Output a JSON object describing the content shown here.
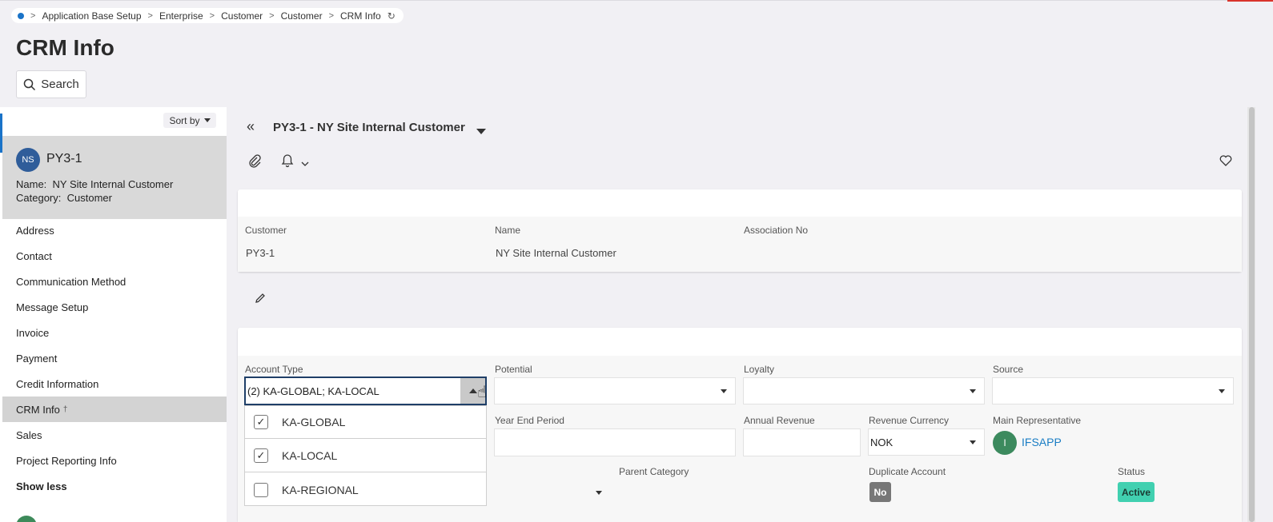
{
  "breadcrumb": {
    "items": [
      "Application Base Setup",
      "Enterprise",
      "Customer",
      "Customer",
      "CRM Info"
    ],
    "separator": ">"
  },
  "page": {
    "title": "CRM Info",
    "search_label": "Search"
  },
  "left_panel": {
    "sort_label": "Sort by",
    "record": {
      "initials": "NS",
      "id": "PY3-1",
      "name_label": "Name:",
      "name_value": "NY Site Internal Customer",
      "category_label": "Category:",
      "category_value": "Customer"
    },
    "nav_items": [
      "Address",
      "Contact",
      "Communication Method",
      "Message Setup",
      "Invoice",
      "Payment",
      "Credit Information",
      "CRM Info",
      "Sales",
      "Project Reporting Info"
    ],
    "active_item": "CRM Info",
    "show_less": "Show less"
  },
  "main": {
    "header_title": "PY3-1 - NY Site Internal Customer",
    "card1": {
      "fields": [
        {
          "label": "Customer",
          "value": "PY3-1"
        },
        {
          "label": "Name",
          "value": "NY Site Internal Customer"
        },
        {
          "label": "Association No",
          "value": ""
        }
      ]
    },
    "card2": {
      "account_type": {
        "label": "Account Type",
        "value": "(2) KA-GLOBAL; KA-LOCAL"
      },
      "potential": {
        "label": "Potential",
        "value": ""
      },
      "loyalty": {
        "label": "Loyalty",
        "value": ""
      },
      "source": {
        "label": "Source",
        "value": ""
      },
      "year_end_period": {
        "label": "Year End Period",
        "value": ""
      },
      "annual_revenue": {
        "label": "Annual Revenue",
        "value": ""
      },
      "revenue_currency": {
        "label": "Revenue Currency",
        "value": "NOK"
      },
      "main_representative": {
        "label": "Main Representative",
        "initial": "I",
        "value": "IFSAPP"
      },
      "parent_category": {
        "label": "Parent Category"
      },
      "duplicate_account": {
        "label": "Duplicate Account",
        "value": "No"
      },
      "status": {
        "label": "Status",
        "value": "Active"
      }
    },
    "account_type_options": [
      {
        "label": "KA-GLOBAL",
        "checked": true
      },
      {
        "label": "KA-LOCAL",
        "checked": true
      },
      {
        "label": "KA-REGIONAL",
        "checked": false
      }
    ]
  },
  "colors": {
    "accent_blue": "#1a73c8",
    "active_badge": "#41d0b0",
    "link": "#1a7dc4"
  }
}
